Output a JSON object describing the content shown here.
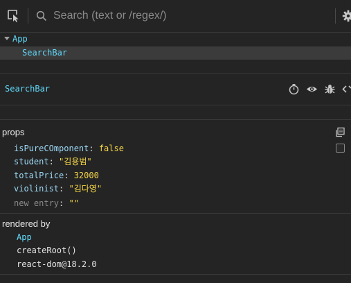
{
  "toolbar": {
    "search_placeholder": "Search (text or /regex/)",
    "inspect_icon": "select-element-icon",
    "search_icon": "search-icon",
    "settings_icon": "gear-icon"
  },
  "tree": {
    "root_label": "App",
    "selected_label": "SearchBar"
  },
  "selected": {
    "name": "SearchBar",
    "icons": [
      "stopwatch-icon",
      "eye-icon",
      "bug-icon",
      "code-icon"
    ]
  },
  "props": {
    "title": "props",
    "items": [
      {
        "key": "isPureCOmponent",
        "value": "false"
      },
      {
        "key": "student",
        "value": "\"김용범\""
      },
      {
        "key": "totalPrice",
        "value": "32000"
      },
      {
        "key": "violinist",
        "value": "\"김다영\""
      }
    ],
    "new_entry": {
      "key": "new entry",
      "value": "\"\""
    }
  },
  "rendered_by": {
    "title": "rendered by",
    "items": [
      "App",
      "createRoot()",
      "react-dom@18.2.0"
    ]
  },
  "colors": {
    "background": "#242424",
    "accent": "#61dafb",
    "value": "#f5d547",
    "selection": "#3b3b3b"
  }
}
